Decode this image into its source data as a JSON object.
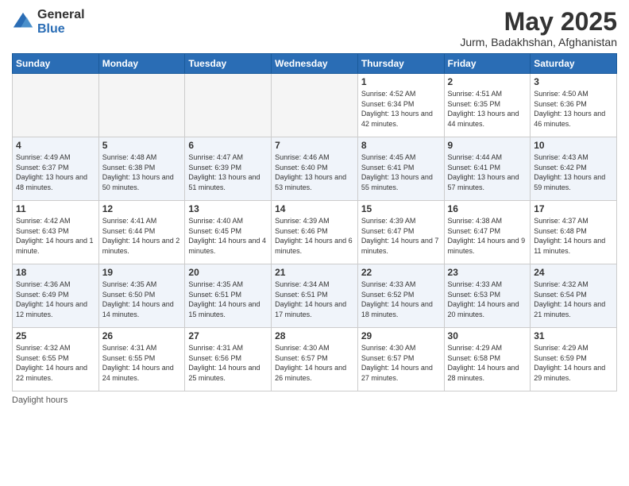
{
  "logo": {
    "general": "General",
    "blue": "Blue"
  },
  "header": {
    "month": "May 2025",
    "location": "Jurm, Badakhshan, Afghanistan"
  },
  "days_of_week": [
    "Sunday",
    "Monday",
    "Tuesday",
    "Wednesday",
    "Thursday",
    "Friday",
    "Saturday"
  ],
  "weeks": [
    [
      {
        "day": "",
        "info": ""
      },
      {
        "day": "",
        "info": ""
      },
      {
        "day": "",
        "info": ""
      },
      {
        "day": "",
        "info": ""
      },
      {
        "day": "1",
        "info": "Sunrise: 4:52 AM\nSunset: 6:34 PM\nDaylight: 13 hours and 42 minutes."
      },
      {
        "day": "2",
        "info": "Sunrise: 4:51 AM\nSunset: 6:35 PM\nDaylight: 13 hours and 44 minutes."
      },
      {
        "day": "3",
        "info": "Sunrise: 4:50 AM\nSunset: 6:36 PM\nDaylight: 13 hours and 46 minutes."
      }
    ],
    [
      {
        "day": "4",
        "info": "Sunrise: 4:49 AM\nSunset: 6:37 PM\nDaylight: 13 hours and 48 minutes."
      },
      {
        "day": "5",
        "info": "Sunrise: 4:48 AM\nSunset: 6:38 PM\nDaylight: 13 hours and 50 minutes."
      },
      {
        "day": "6",
        "info": "Sunrise: 4:47 AM\nSunset: 6:39 PM\nDaylight: 13 hours and 51 minutes."
      },
      {
        "day": "7",
        "info": "Sunrise: 4:46 AM\nSunset: 6:40 PM\nDaylight: 13 hours and 53 minutes."
      },
      {
        "day": "8",
        "info": "Sunrise: 4:45 AM\nSunset: 6:41 PM\nDaylight: 13 hours and 55 minutes."
      },
      {
        "day": "9",
        "info": "Sunrise: 4:44 AM\nSunset: 6:41 PM\nDaylight: 13 hours and 57 minutes."
      },
      {
        "day": "10",
        "info": "Sunrise: 4:43 AM\nSunset: 6:42 PM\nDaylight: 13 hours and 59 minutes."
      }
    ],
    [
      {
        "day": "11",
        "info": "Sunrise: 4:42 AM\nSunset: 6:43 PM\nDaylight: 14 hours and 1 minute."
      },
      {
        "day": "12",
        "info": "Sunrise: 4:41 AM\nSunset: 6:44 PM\nDaylight: 14 hours and 2 minutes."
      },
      {
        "day": "13",
        "info": "Sunrise: 4:40 AM\nSunset: 6:45 PM\nDaylight: 14 hours and 4 minutes."
      },
      {
        "day": "14",
        "info": "Sunrise: 4:39 AM\nSunset: 6:46 PM\nDaylight: 14 hours and 6 minutes."
      },
      {
        "day": "15",
        "info": "Sunrise: 4:39 AM\nSunset: 6:47 PM\nDaylight: 14 hours and 7 minutes."
      },
      {
        "day": "16",
        "info": "Sunrise: 4:38 AM\nSunset: 6:47 PM\nDaylight: 14 hours and 9 minutes."
      },
      {
        "day": "17",
        "info": "Sunrise: 4:37 AM\nSunset: 6:48 PM\nDaylight: 14 hours and 11 minutes."
      }
    ],
    [
      {
        "day": "18",
        "info": "Sunrise: 4:36 AM\nSunset: 6:49 PM\nDaylight: 14 hours and 12 minutes."
      },
      {
        "day": "19",
        "info": "Sunrise: 4:35 AM\nSunset: 6:50 PM\nDaylight: 14 hours and 14 minutes."
      },
      {
        "day": "20",
        "info": "Sunrise: 4:35 AM\nSunset: 6:51 PM\nDaylight: 14 hours and 15 minutes."
      },
      {
        "day": "21",
        "info": "Sunrise: 4:34 AM\nSunset: 6:51 PM\nDaylight: 14 hours and 17 minutes."
      },
      {
        "day": "22",
        "info": "Sunrise: 4:33 AM\nSunset: 6:52 PM\nDaylight: 14 hours and 18 minutes."
      },
      {
        "day": "23",
        "info": "Sunrise: 4:33 AM\nSunset: 6:53 PM\nDaylight: 14 hours and 20 minutes."
      },
      {
        "day": "24",
        "info": "Sunrise: 4:32 AM\nSunset: 6:54 PM\nDaylight: 14 hours and 21 minutes."
      }
    ],
    [
      {
        "day": "25",
        "info": "Sunrise: 4:32 AM\nSunset: 6:55 PM\nDaylight: 14 hours and 22 minutes."
      },
      {
        "day": "26",
        "info": "Sunrise: 4:31 AM\nSunset: 6:55 PM\nDaylight: 14 hours and 24 minutes."
      },
      {
        "day": "27",
        "info": "Sunrise: 4:31 AM\nSunset: 6:56 PM\nDaylight: 14 hours and 25 minutes."
      },
      {
        "day": "28",
        "info": "Sunrise: 4:30 AM\nSunset: 6:57 PM\nDaylight: 14 hours and 26 minutes."
      },
      {
        "day": "29",
        "info": "Sunrise: 4:30 AM\nSunset: 6:57 PM\nDaylight: 14 hours and 27 minutes."
      },
      {
        "day": "30",
        "info": "Sunrise: 4:29 AM\nSunset: 6:58 PM\nDaylight: 14 hours and 28 minutes."
      },
      {
        "day": "31",
        "info": "Sunrise: 4:29 AM\nSunset: 6:59 PM\nDaylight: 14 hours and 29 minutes."
      }
    ]
  ],
  "footer": {
    "label": "Daylight hours"
  },
  "colors": {
    "header_bg": "#2a6db5",
    "alt_row": "#e8eef7",
    "empty_bg": "#f5f5f5"
  }
}
